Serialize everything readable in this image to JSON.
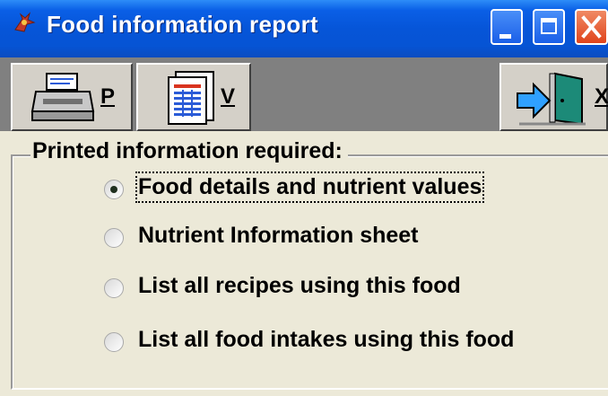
{
  "window": {
    "title": "Food information report",
    "colors": {
      "titlebar": "#0655d8",
      "face": "#ece9d8",
      "close": "#e0441c"
    }
  },
  "toolbar": {
    "print": {
      "icon": "printer-icon",
      "key": "P"
    },
    "view": {
      "icon": "document-view-icon",
      "key": "V"
    },
    "exit": {
      "icon": "exit-door-icon",
      "key": "X"
    }
  },
  "options": {
    "legend": "Printed information required:",
    "items": [
      {
        "label": "Food details and nutrient values",
        "selected": true
      },
      {
        "label": "Nutrient Information sheet",
        "selected": false
      },
      {
        "label": "List all recipes using this food",
        "selected": false
      },
      {
        "label": "List all food intakes using this food",
        "selected": false
      }
    ]
  }
}
